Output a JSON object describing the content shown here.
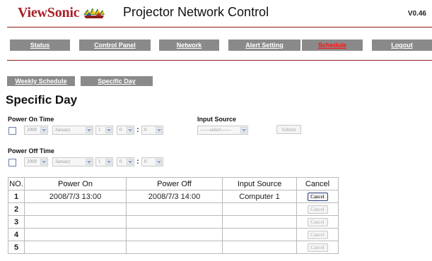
{
  "header": {
    "logo_text": "ViewSonic",
    "app_title": "Projector Network Control",
    "version": "V0.46"
  },
  "nav": {
    "items": [
      {
        "label": "Status",
        "active": false
      },
      {
        "label": "Control Panel",
        "active": false
      },
      {
        "label": "Network",
        "active": false
      },
      {
        "label": "Alert Setting",
        "active": false
      },
      {
        "label": "Schedule",
        "active": true
      },
      {
        "label": "Logout",
        "active": false
      }
    ]
  },
  "subnav": {
    "items": [
      {
        "label": "Weekly Schedule"
      },
      {
        "label": "Specific Day"
      }
    ]
  },
  "page_title": "Specific Day",
  "power_on": {
    "label": "Power On Time",
    "year": "2008",
    "month": "January",
    "day": "1",
    "hour": "0",
    "minute": "0",
    "separator": ":"
  },
  "input_source": {
    "label": "Input Source",
    "value": "------select------",
    "submit_label": "Submit"
  },
  "power_off": {
    "label": "Power Off Time",
    "year": "2008",
    "month": "January",
    "day": "1",
    "hour": "0",
    "minute": "0",
    "separator": ":"
  },
  "table": {
    "headers": [
      "NO.",
      "Power On",
      "Power Off",
      "Input Source",
      "Cancel"
    ],
    "rows": [
      {
        "no": "1",
        "power_on": "2008/7/3 13:00",
        "power_off": "2008/7/3 14:00",
        "input_source": "Computer 1",
        "cancel": "Cancel",
        "enabled": true
      },
      {
        "no": "2",
        "power_on": "",
        "power_off": "",
        "input_source": "",
        "cancel": "Cancel",
        "enabled": false
      },
      {
        "no": "3",
        "power_on": "",
        "power_off": "",
        "input_source": "",
        "cancel": "Cancel",
        "enabled": false
      },
      {
        "no": "4",
        "power_on": "",
        "power_off": "",
        "input_source": "",
        "cancel": "Cancel",
        "enabled": false
      },
      {
        "no": "5",
        "power_on": "",
        "power_off": "",
        "input_source": "",
        "cancel": "Cancel",
        "enabled": false
      }
    ]
  },
  "colors": {
    "brand_red": "#a8202a",
    "nav_bg": "#8a8a8a",
    "nav_active": "#ff1010",
    "rule": "#8c1a1a"
  }
}
